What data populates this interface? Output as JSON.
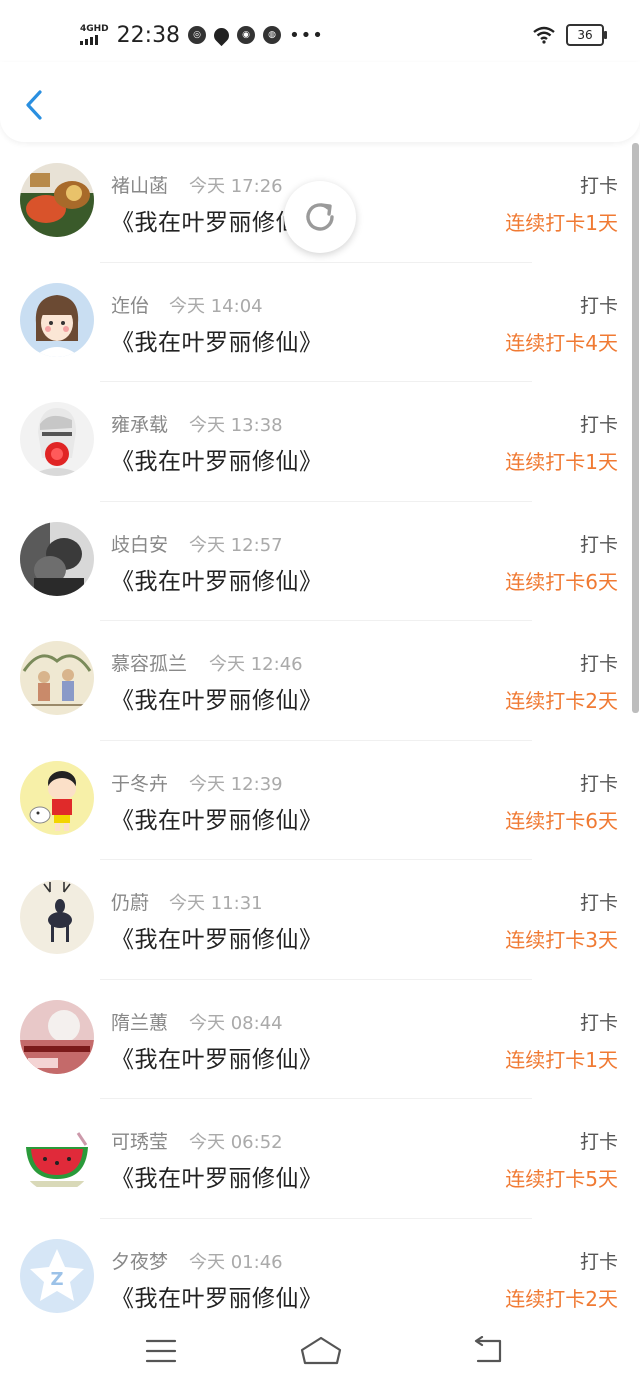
{
  "status_bar": {
    "network": "4GHD",
    "time": "22:38",
    "battery": "36"
  },
  "checkins": [
    {
      "name": "褚山菡",
      "time": "今天 17:26",
      "book": "《我在叶罗丽修仙》",
      "action": "打卡",
      "streak": "连续打卡1天",
      "avatar": "food-avatar"
    },
    {
      "name": "迮佁",
      "time": "今天 14:04",
      "book": "《我在叶罗丽修仙》",
      "action": "打卡",
      "streak": "连续打卡4天",
      "avatar": "cartoon-girl-avatar"
    },
    {
      "name": "雍承载",
      "time": "今天 13:38",
      "book": "《我在叶罗丽修仙》",
      "action": "打卡",
      "streak": "连续打卡1天",
      "avatar": "person-mask-avatar"
    },
    {
      "name": "歧白安",
      "time": "今天 12:57",
      "book": "《我在叶罗丽修仙》",
      "action": "打卡",
      "streak": "连续打卡6天",
      "avatar": "bw-photo-avatar"
    },
    {
      "name": "慕容孤兰",
      "time": "今天 12:46",
      "book": "《我在叶罗丽修仙》",
      "action": "打卡",
      "streak": "连续打卡2天",
      "avatar": "illustration-avatar"
    },
    {
      "name": "于冬卉",
      "time": "今天 12:39",
      "book": "《我在叶罗丽修仙》",
      "action": "打卡",
      "streak": "连续打卡6天",
      "avatar": "crayon-shinchan-avatar"
    },
    {
      "name": "仍蔚",
      "time": "今天 11:31",
      "book": "《我在叶罗丽修仙》",
      "action": "打卡",
      "streak": "连续打卡3天",
      "avatar": "deer-avatar"
    },
    {
      "name": "隋兰蕙",
      "time": "今天 08:44",
      "book": "《我在叶罗丽修仙》",
      "action": "打卡",
      "streak": "连续打卡1天",
      "avatar": "photo-text-avatar"
    },
    {
      "name": "可琇莹",
      "time": "今天 06:52",
      "book": "《我在叶罗丽修仙》",
      "action": "打卡",
      "streak": "连续打卡5天",
      "avatar": "watermelon-avatar"
    },
    {
      "name": "夕夜梦",
      "time": "今天 01:46",
      "book": "《我在叶罗丽修仙》",
      "action": "打卡",
      "streak": "连续打卡2天",
      "avatar": "qq-default-avatar"
    }
  ],
  "colors": {
    "accent": "#f07a33",
    "back": "#2a8fe0"
  }
}
